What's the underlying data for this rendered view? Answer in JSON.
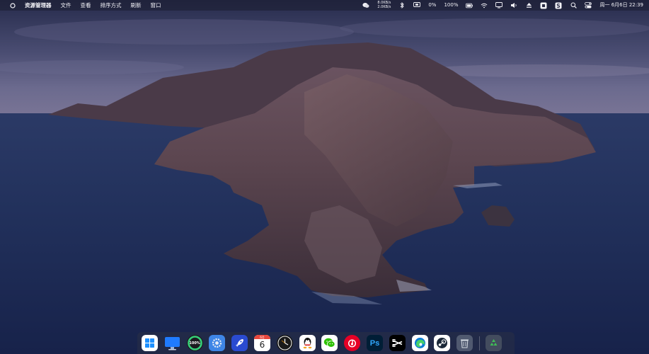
{
  "menubar": {
    "logo": "circle-logo-icon",
    "app_name": "资源管理器",
    "menus": [
      "文件",
      "查看",
      "排序方式",
      "刷新",
      "窗口"
    ],
    "tray": {
      "wechat": "wechat-icon",
      "net_up": "8.0KB/s",
      "net_down": "2.0KB/s",
      "bluetooth": "bluetooth-icon",
      "cpu_usage": "0%",
      "battery": "100%",
      "clock": "周一 6月6日 22:39"
    }
  },
  "dock": {
    "apps": [
      {
        "name": "windows-start-icon"
      },
      {
        "name": "desktop-icon"
      },
      {
        "name": "progress-ring-icon",
        "label": "100%"
      },
      {
        "name": "settings-icon"
      },
      {
        "name": "launchpad-rocket-icon"
      },
      {
        "name": "calendar-icon",
        "month": "6月",
        "day": "6"
      },
      {
        "name": "clock-icon"
      },
      {
        "name": "qq-icon"
      },
      {
        "name": "wechat-icon"
      },
      {
        "name": "netease-music-icon"
      },
      {
        "name": "photoshop-icon",
        "label": "Ps"
      },
      {
        "name": "capcut-icon"
      },
      {
        "name": "edge-browser-icon"
      },
      {
        "name": "steam-icon"
      },
      {
        "name": "trash-icon"
      },
      {
        "name": "recycle-bin-icon"
      }
    ]
  },
  "colors": {
    "menubar_bg": "#1c1e30",
    "dock_bg": "#262c46",
    "sky_top": "#2a3256",
    "sea": "#1d2a4f"
  }
}
